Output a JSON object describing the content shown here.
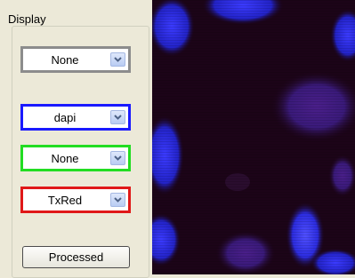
{
  "panel": {
    "title": "Display",
    "channels": [
      {
        "value": "None",
        "border_color": "#8c8c8c"
      },
      {
        "value": "dapi",
        "border_color": "#1a1aff"
      },
      {
        "value": "None",
        "border_color": "#22dd22"
      },
      {
        "value": "TxRed",
        "border_color": "#e01818"
      }
    ],
    "processed_button": "Processed"
  },
  "image": {
    "description_icon": "microscopy-nuclei-image",
    "background_color": "#1c0418",
    "nucleus_color": "#2a2ad8"
  }
}
